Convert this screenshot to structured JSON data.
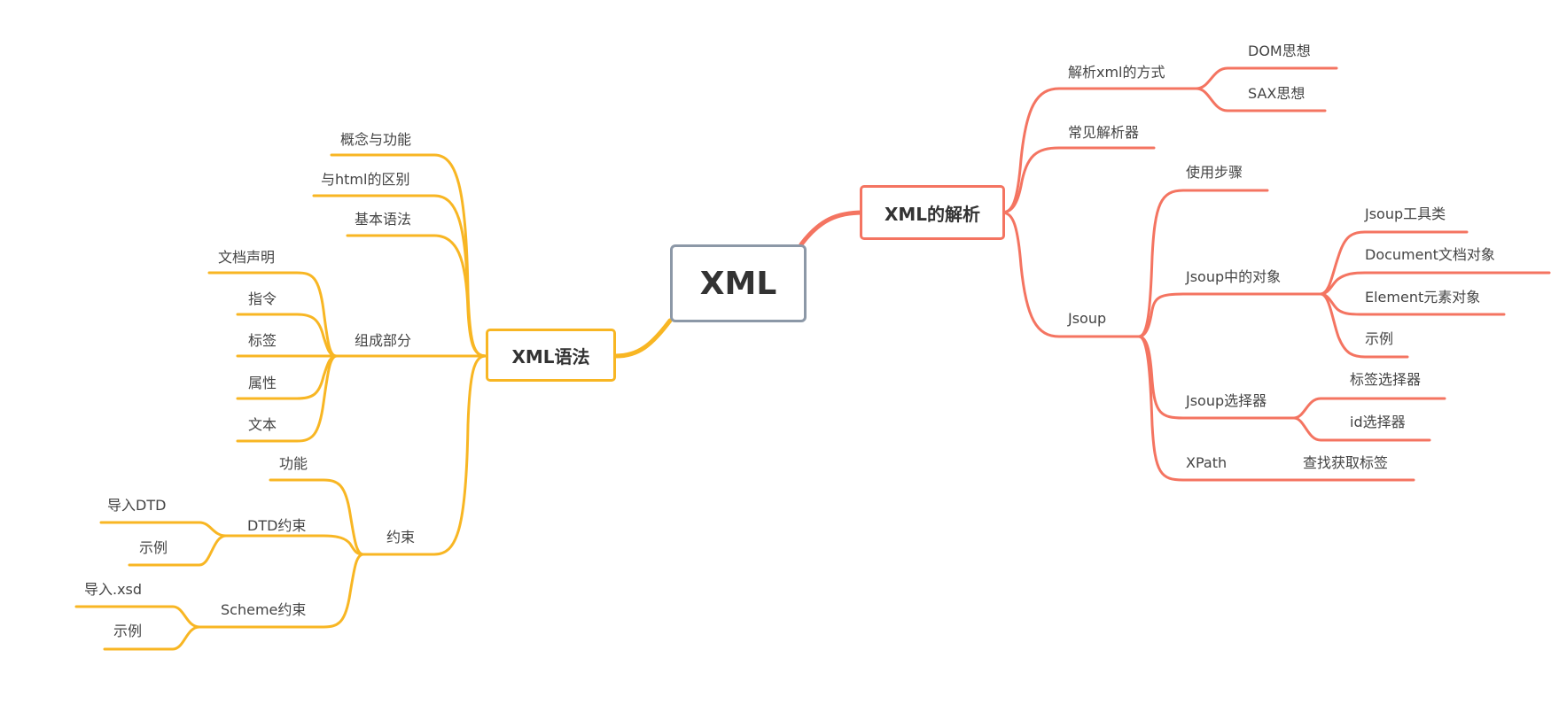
{
  "colors": {
    "root_border": "#8c98a7",
    "left_branch": "#f8b623",
    "right_branch": "#f47461"
  },
  "root": {
    "label": "XML"
  },
  "left_branch": {
    "label": "XML语法",
    "children": [
      {
        "label": "概念与功能"
      },
      {
        "label": "与html的区别"
      },
      {
        "label": "基本语法"
      },
      {
        "label": "组成部分",
        "children": [
          {
            "label": "文档声明"
          },
          {
            "label": "指令"
          },
          {
            "label": "标签"
          },
          {
            "label": "属性"
          },
          {
            "label": "文本"
          }
        ]
      },
      {
        "label": "约束",
        "children": [
          {
            "label": "功能"
          },
          {
            "label": "DTD约束",
            "children": [
              {
                "label": "导入DTD"
              },
              {
                "label": "示例"
              }
            ]
          },
          {
            "label": "Scheme约束",
            "children": [
              {
                "label": "导入.xsd"
              },
              {
                "label": "示例"
              }
            ]
          }
        ]
      }
    ]
  },
  "right_branch": {
    "label": "XML的解析",
    "children": [
      {
        "label": "解析xml的方式",
        "children": [
          {
            "label": "DOM思想"
          },
          {
            "label": "SAX思想"
          }
        ]
      },
      {
        "label": "常见解析器"
      },
      {
        "label": "Jsoup",
        "children": [
          {
            "label": "使用步骤"
          },
          {
            "label": "Jsoup中的对象",
            "children": [
              {
                "label": "Jsoup工具类"
              },
              {
                "label": "Document文档对象"
              },
              {
                "label": "Element元素对象"
              },
              {
                "label": "示例"
              }
            ]
          },
          {
            "label": "Jsoup选择器",
            "children": [
              {
                "label": "标签选择器"
              },
              {
                "label": "id选择器"
              }
            ]
          },
          {
            "label": "XPath",
            "children": [
              {
                "label": "查找获取标签"
              }
            ]
          }
        ]
      }
    ]
  }
}
